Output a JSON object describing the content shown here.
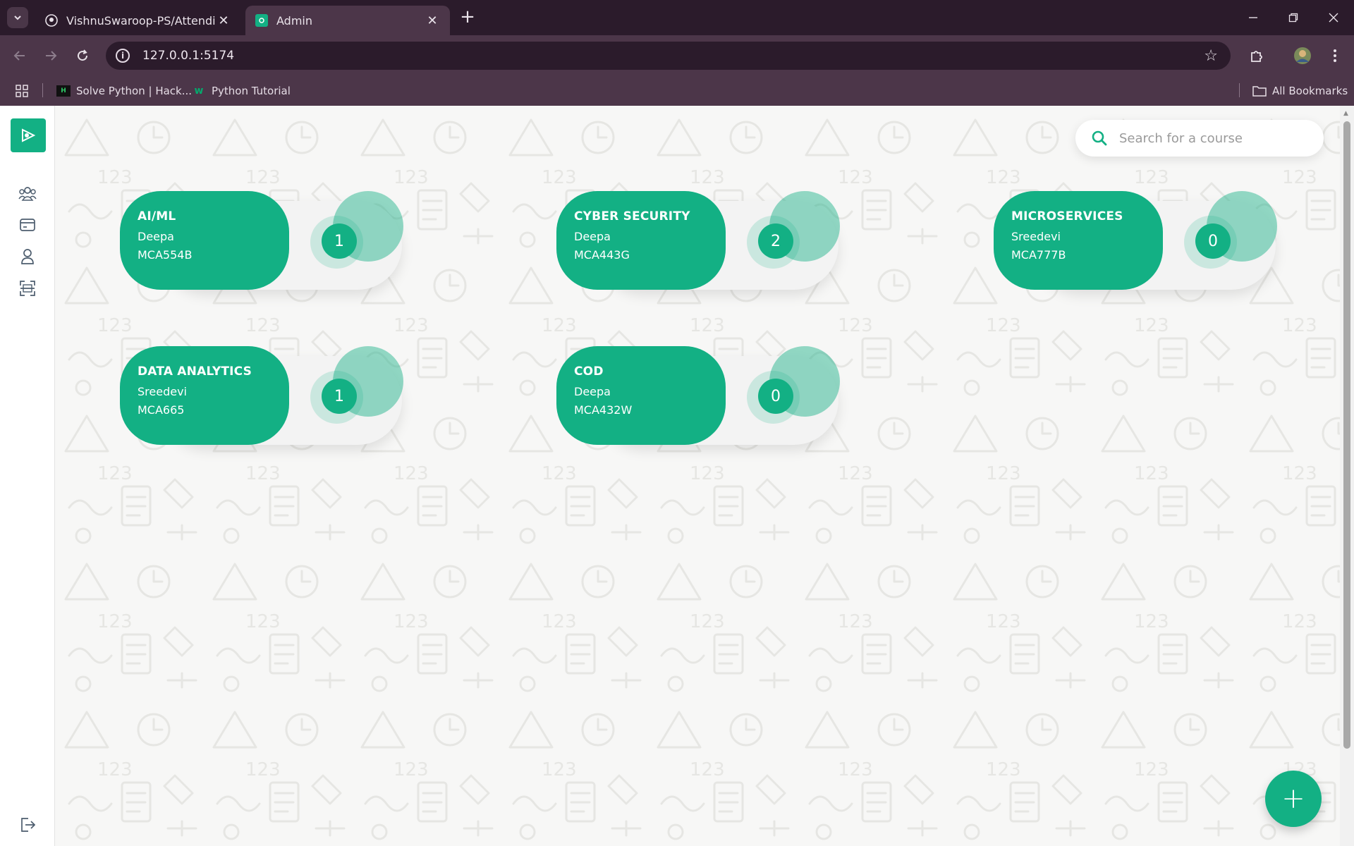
{
  "browser": {
    "tabs": [
      {
        "title": "VishnuSwaroop-PS/Attendify",
        "icon": "github-icon"
      },
      {
        "title": "Admin",
        "icon": "app-favicon"
      }
    ],
    "url": "127.0.0.1:5174",
    "bookmarks": [
      {
        "label": "Solve Python | Hack...",
        "icon": "hackerrank-icon"
      },
      {
        "label": "Python Tutorial",
        "icon": "w3schools-icon"
      }
    ],
    "all_bookmarks_label": "All Bookmarks"
  },
  "search": {
    "placeholder": "Search for a course"
  },
  "courses": [
    {
      "name": "AI/ML",
      "teacher": "Deepa",
      "code": "MCA554B",
      "count": "1"
    },
    {
      "name": "CYBER SECURITY",
      "teacher": "Deepa",
      "code": "MCA443G",
      "count": "2"
    },
    {
      "name": "MICROSERVICES",
      "teacher": "Sreedevi",
      "code": "MCA777B",
      "count": "0"
    },
    {
      "name": "DATA ANALYTICS",
      "teacher": "Sreedevi",
      "code": "MCA665",
      "count": "1"
    },
    {
      "name": "COD",
      "teacher": "Deepa",
      "code": "MCA432W",
      "count": "0"
    }
  ],
  "fab": {
    "label": "+"
  },
  "colors": {
    "accent": "#13b084",
    "chrome_dark": "#2b1b2b",
    "chrome": "#4c3649"
  }
}
